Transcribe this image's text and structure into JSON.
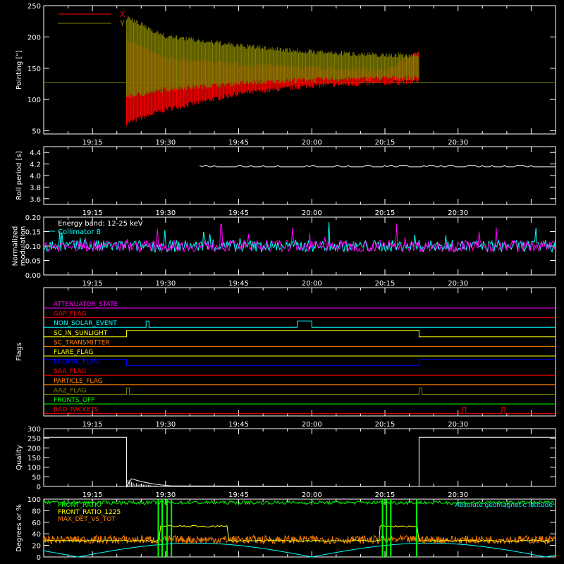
{
  "chart_data": [
    {
      "type": "line",
      "ylabel": "Pointing [\"]",
      "ylim": [
        45,
        250
      ],
      "yticks": [
        50,
        100,
        150,
        200,
        250
      ],
      "xlim": [
        "19:05",
        "20:50"
      ],
      "xticks": [
        "19:15",
        "19:30",
        "19:45",
        "20:00",
        "20:15",
        "20:30"
      ],
      "legend": [
        {
          "name": "X",
          "color": "#ff0000"
        },
        {
          "name": "Y",
          "color": "#808000"
        }
      ],
      "baseline": 127,
      "series": [
        {
          "name": "X",
          "color": "#ff0000",
          "x": [
            "19:22",
            "19:30",
            "19:45",
            "20:00",
            "20:15",
            "20:22"
          ],
          "lower": [
            58,
            80,
            105,
            118,
            122,
            125
          ],
          "upper": [
            200,
            170,
            160,
            155,
            150,
            180
          ]
        },
        {
          "name": "Y",
          "color": "#808000",
          "x": [
            "19:22",
            "19:30",
            "19:45",
            "20:00",
            "20:15",
            "20:22"
          ],
          "lower": [
            100,
            112,
            122,
            128,
            130,
            130
          ],
          "upper": [
            235,
            205,
            190,
            180,
            175,
            175
          ]
        }
      ]
    },
    {
      "type": "line",
      "ylabel": "Roll period [s]",
      "ylim": [
        3.5,
        4.5
      ],
      "yticks": [
        "3.6",
        "3.8",
        "4.0",
        "4.2",
        "4.4"
      ],
      "xticks": [
        "19:15",
        "19:30",
        "19:45",
        "20:00",
        "20:15",
        "20:30"
      ],
      "series": [
        {
          "name": "roll",
          "color": "#ffffff",
          "x": [
            "19:37",
            "20:50"
          ],
          "y": [
            4.15,
            4.15
          ]
        }
      ]
    },
    {
      "type": "line",
      "ylabel": "Normalized modulation",
      "ylim": [
        0,
        0.2
      ],
      "yticks": [
        "0.00",
        "0.05",
        "0.10",
        "0.15",
        "0.20"
      ],
      "xticks": [
        "19:15",
        "19:30",
        "19:45",
        "20:00",
        "20:15",
        "20:30"
      ],
      "annotations": [
        "Energy band: 12-25 keV"
      ],
      "series": [
        {
          "name": "Collimator 8",
          "color": "#00ffff",
          "mean": 0.1
        },
        {
          "name": "",
          "color": "#ff00ff",
          "mean": 0.1
        }
      ]
    },
    {
      "type": "line",
      "ylabel": "Flags",
      "xticks": [
        "19:15",
        "19:30",
        "19:45",
        "20:00",
        "20:15",
        "20:30"
      ],
      "flags": [
        {
          "name": "ATTENUATOR_STATE",
          "color": "#ff00ff",
          "high": []
        },
        {
          "name": "GAP_FLAG",
          "color": "#ff0000",
          "high": []
        },
        {
          "name": "NON_SOLAR_EVENT",
          "color": "#00ffff",
          "high": [
            [
              "19:26",
              "19:26"
            ],
            [
              "19:57",
              "20:00"
            ]
          ]
        },
        {
          "name": "SC_IN_SUNLIGHT",
          "color": "#ffff00",
          "high": [
            [
              "19:22",
              "20:22"
            ]
          ]
        },
        {
          "name": "SC_TRANSMITTER",
          "color": "#ff8000",
          "high": []
        },
        {
          "name": "FLARE_FLAG",
          "color": "#ffff00",
          "high": []
        },
        {
          "name": "ECLIPSE_FLAG",
          "color": "#0000ff",
          "high": [
            [
              "19:05",
              "19:22"
            ],
            [
              "20:22",
              "20:50"
            ]
          ]
        },
        {
          "name": "SAA_FLAG",
          "color": "#ff0000",
          "high": []
        },
        {
          "name": "PARTICLE_FLAG",
          "color": "#ff8000",
          "high": []
        },
        {
          "name": "AAZ_FLAG",
          "color": "#808000",
          "high": [
            [
              "19:22",
              "19:22"
            ],
            [
              "20:22",
              "20:22"
            ]
          ]
        },
        {
          "name": "FRONTS_OFF",
          "color": "#00ff00",
          "high": []
        },
        {
          "name": "BAD_PACKETS",
          "color": "#ff0000",
          "high": [
            [
              "20:31",
              "20:31"
            ],
            [
              "20:39",
              "20:39"
            ]
          ]
        }
      ]
    },
    {
      "type": "line",
      "ylabel": "Quality",
      "ylim": [
        0,
        300
      ],
      "yticks": [
        "0",
        "50",
        "100",
        "150",
        "200",
        "250",
        "300"
      ],
      "xticks": [
        "19:15",
        "19:30",
        "19:45",
        "20:00",
        "20:15",
        "20:30"
      ],
      "series": [
        {
          "name": "quality",
          "color": "#ffffff",
          "x": [
            "19:05",
            "19:22",
            "19:22",
            "19:23",
            "19:25",
            "19:27",
            "19:29",
            "19:31",
            "20:22",
            "20:22",
            "20:50"
          ],
          "y": [
            255,
            255,
            0,
            40,
            25,
            15,
            8,
            3,
            0,
            255,
            255
          ]
        }
      ]
    },
    {
      "type": "line",
      "ylabel": "Degrees or %",
      "ylim": [
        0,
        100
      ],
      "yticks": [
        "0",
        "20",
        "40",
        "60",
        "80",
        "100"
      ],
      "legend_right": "Absolute geomagnetic latitude",
      "series": [
        {
          "name": "FRONT_RATIO",
          "color": "#00ff00",
          "level": 94
        },
        {
          "name": "FRONT_RATIO_1225",
          "color": "#ffff00",
          "level": 52
        },
        {
          "name": "MAX_DET_VS_TOT",
          "color": "#ff8000",
          "level": 30
        },
        {
          "name": "Absolute geomagnetic latitude",
          "color": "#00ffff",
          "min": 0,
          "max": 24
        }
      ]
    }
  ]
}
